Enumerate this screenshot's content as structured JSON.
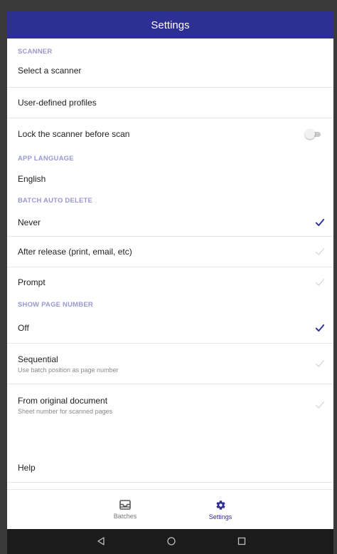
{
  "appbar": {
    "title": "Settings"
  },
  "sections": {
    "scanner": {
      "header": "SCANNER",
      "select_scanner": "Select a scanner",
      "user_profiles": "User-defined profiles",
      "lock_scanner": "Lock the scanner before scan",
      "lock_scanner_enabled": false
    },
    "app_language": {
      "header": "APP LANGUAGE",
      "value": "English"
    },
    "batch_auto_delete": {
      "header": "BATCH AUTO DELETE",
      "options": [
        {
          "label": "Never",
          "selected": true
        },
        {
          "label": "After release (print, email, etc)",
          "selected": false
        },
        {
          "label": "Prompt",
          "selected": false
        }
      ]
    },
    "show_page_number": {
      "header": "SHOW PAGE NUMBER",
      "options": [
        {
          "label": "Off",
          "sublabel": "",
          "selected": true
        },
        {
          "label": "Sequential",
          "sublabel": "Use batch position as page number",
          "selected": false
        },
        {
          "label": "From original document",
          "sublabel": "Sheet number for scanned pages",
          "selected": false
        }
      ]
    },
    "help": {
      "label": "Help"
    }
  },
  "bottom_nav": {
    "items": [
      {
        "label": "Batches",
        "icon": "tray-icon",
        "active": false
      },
      {
        "label": "Settings",
        "icon": "gear-icon",
        "active": true
      }
    ]
  },
  "system_nav": {
    "buttons": [
      "back-icon",
      "home-icon",
      "recents-icon"
    ]
  },
  "colors": {
    "primary": "#2e2f94",
    "section_header": "#9a98cf",
    "check_selected": "#2e2f94",
    "check_unselected": "#d9d9d9"
  }
}
